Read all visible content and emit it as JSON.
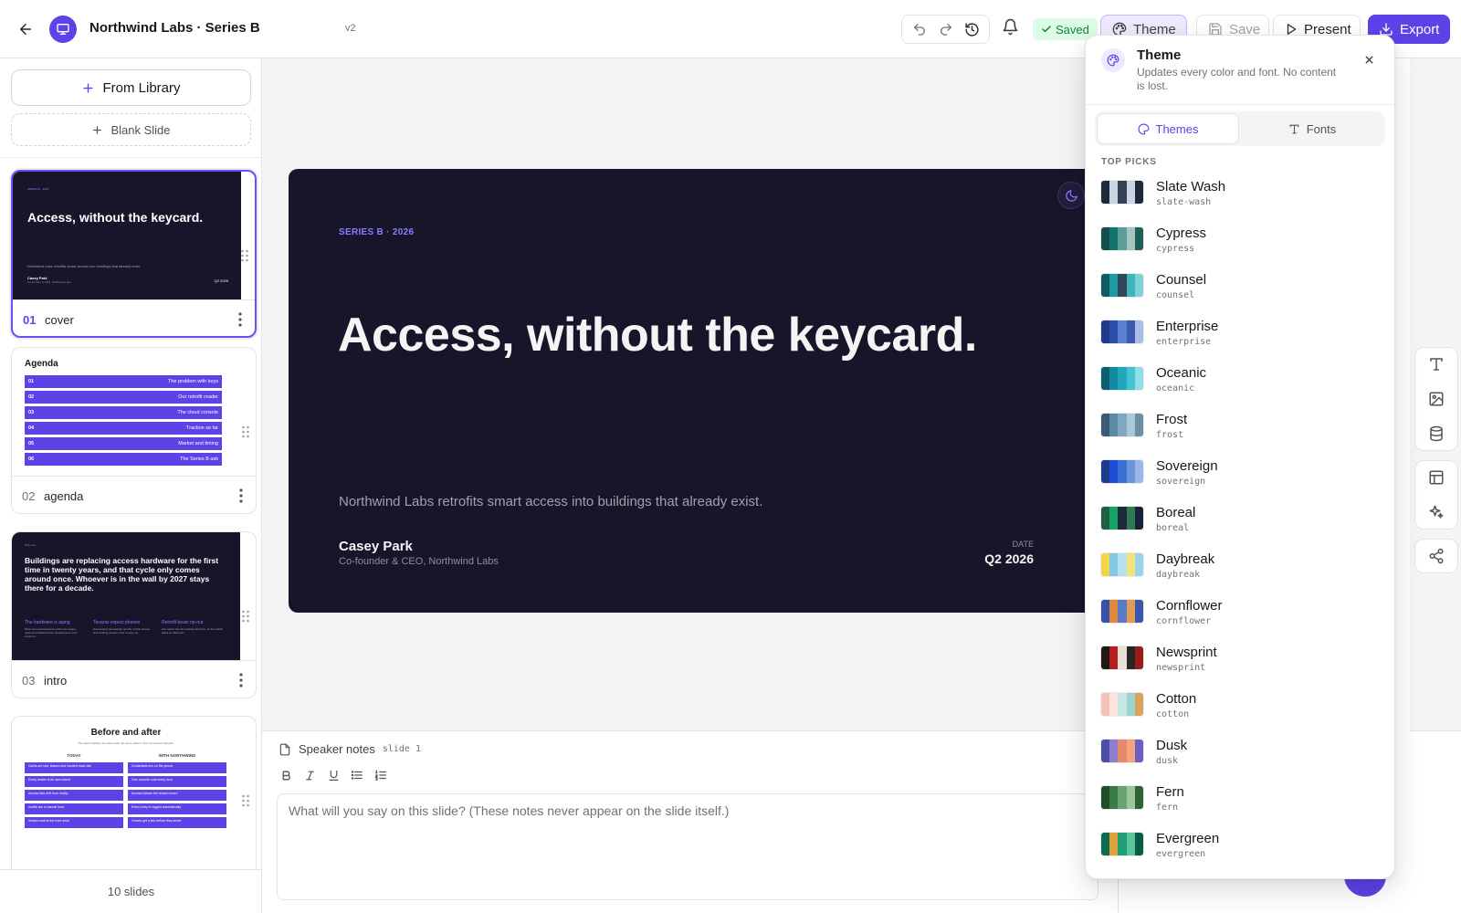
{
  "header": {
    "deck_title": "Northwind Labs · Series B",
    "version": "v2",
    "saved_label": "Saved",
    "theme_label": "Theme",
    "save_label": "Save",
    "present_label": "Present",
    "export_label": "Export"
  },
  "sidebar": {
    "from_library_label": "From Library",
    "blank_slide_label": "Blank Slide",
    "slide_count": "10 slides",
    "slides": [
      {
        "num": "01",
        "name": "cover"
      },
      {
        "num": "02",
        "name": "agenda"
      },
      {
        "num": "03",
        "name": "intro"
      }
    ]
  },
  "thumbs": {
    "cover": {
      "eyebrow": "SERIES B · 2026",
      "title": "Access, without the keycard.",
      "sub": "Northwind Labs retrofits smart access into buildings that already exist.",
      "author": "Casey Park",
      "role": "Co-founder & CEO, Northwind Labs",
      "date": "Q2 2026"
    },
    "agenda": {
      "title": "Agenda",
      "items": [
        {
          "n": "01",
          "t": "The problem with keys"
        },
        {
          "n": "02",
          "t": "Our retrofit reader"
        },
        {
          "n": "03",
          "t": "The cloud console"
        },
        {
          "n": "04",
          "t": "Traction so far"
        },
        {
          "n": "05",
          "t": "Market and timing"
        },
        {
          "n": "06",
          "t": "The Series B ask"
        }
      ]
    },
    "intro": {
      "eyebrow": "Why now",
      "title": "Buildings are replacing access hardware for the first time in twenty years, and that cycle only comes around once. Whoever is in the wall by 2027 stays there for a decade.",
      "cols": [
        {
          "h": "The hardware is aging",
          "b": "Most commercial access points are legacy systems installed before smartphones were common."
        },
        {
          "h": "Tenants expect phones",
          "b": "New leases increasingly specify mobile access and building owners need to keep up."
        },
        {
          "h": "Retrofit beats rip-out",
          "b": "Our reader fits the existing back box, so the install takes an afternoon."
        }
      ]
    },
    "before_after": {
      "title": "Before and after",
      "sub": "The same building, the same staff, the same visitors. Only the access changes.",
      "left_header": "TODAY",
      "right_header": "WITH NORTHWIND",
      "left_rows": [
        "Cards are lost, shared and handed back late",
        "Every reader is its own island",
        "Access lists drift from reality",
        "Audits are a manual hunt",
        "Visitors wait at the front desk"
      ],
      "right_rows": [
        "Credentials live on the phone",
        "One console runs every door",
        "Access follows the tenant record",
        "Every entry is logged automatically",
        "Guests get a link before they arrive"
      ]
    }
  },
  "slide": {
    "eyebrow": "SERIES B · 2026",
    "title": "Access, without the keycard.",
    "subtitle": "Northwind Labs retrofits smart access into buildings that already exist.",
    "author": "Casey Park",
    "role": "Co-founder & CEO, Northwind Labs",
    "date_label": "DATE",
    "date": "Q2 2026"
  },
  "notes": {
    "label": "Speaker notes",
    "slide_ref": "slide 1",
    "placeholder": "What will you say on this slide? (These notes never appear on the slide itself.)"
  },
  "theme_panel": {
    "title": "Theme",
    "description": "Updates every color and font. No content is lost.",
    "tab_themes": "Themes",
    "tab_fonts": "Fonts",
    "section_label": "TOP PICKS",
    "themes": [
      {
        "name": "Slate Wash",
        "slug": "slate-wash",
        "colors": [
          "#1e293b",
          "#cbd5e1",
          "#334155",
          "#cbd5e1",
          "#1e293b"
        ]
      },
      {
        "name": "Cypress",
        "slug": "cypress",
        "colors": [
          "#134e4a",
          "#0f766e",
          "#5f9e96",
          "#a7c4be",
          "#1f5f57"
        ]
      },
      {
        "name": "Counsel",
        "slug": "counsel",
        "colors": [
          "#0e5b63",
          "#1d9aa3",
          "#33465c",
          "#3fb4bd",
          "#7fd3d6"
        ]
      },
      {
        "name": "Enterprise",
        "slug": "enterprise",
        "colors": [
          "#1e3a8a",
          "#2b4fa8",
          "#5b7fd1",
          "#3b5bb0",
          "#a9bde8"
        ]
      },
      {
        "name": "Oceanic",
        "slug": "oceanic",
        "colors": [
          "#0e5f6e",
          "#138aa0",
          "#1fa7bd",
          "#44c2d4",
          "#8fdde6"
        ]
      },
      {
        "name": "Frost",
        "slug": "frost",
        "colors": [
          "#3b5d73",
          "#5b8aa6",
          "#7fa7c0",
          "#a9c8d8",
          "#6d8fa4"
        ]
      },
      {
        "name": "Sovereign",
        "slug": "sovereign",
        "colors": [
          "#1e3a8a",
          "#1d4ed8",
          "#3b6fd4",
          "#6d93dd",
          "#9db6ea"
        ]
      },
      {
        "name": "Boreal",
        "slug": "boreal",
        "colors": [
          "#1f5f3f",
          "#16a36b",
          "#1e293b",
          "#2f7a55",
          "#16213a"
        ]
      },
      {
        "name": "Daybreak",
        "slug": "daybreak",
        "colors": [
          "#f5d547",
          "#7fc8e8",
          "#b6e1ef",
          "#f2e27a",
          "#9bd3ea"
        ]
      },
      {
        "name": "Cornflower",
        "slug": "cornflower",
        "colors": [
          "#3452a8",
          "#e0873a",
          "#5a78c8",
          "#e39a55",
          "#3a57ad"
        ]
      },
      {
        "name": "Newsprint",
        "slug": "newsprint",
        "colors": [
          "#1c1917",
          "#b91c1c",
          "#e7e1d6",
          "#292524",
          "#991b1b"
        ]
      },
      {
        "name": "Cotton",
        "slug": "cotton",
        "colors": [
          "#f6c1b8",
          "#fbe3de",
          "#c8e6e2",
          "#9fd3cd",
          "#d9a35a"
        ]
      },
      {
        "name": "Dusk",
        "slug": "dusk",
        "colors": [
          "#4b4fa8",
          "#8f7fd1",
          "#e8896b",
          "#f2a57f",
          "#6a5fc0"
        ]
      },
      {
        "name": "Fern",
        "slug": "fern",
        "colors": [
          "#1f4d2b",
          "#3a7a45",
          "#6aa372",
          "#9cc59b",
          "#2e6338"
        ]
      },
      {
        "name": "Evergreen",
        "slug": "evergreen",
        "colors": [
          "#0f6b4f",
          "#e0a33a",
          "#1f9e7a",
          "#5cc49b",
          "#0b5a45"
        ]
      }
    ]
  }
}
